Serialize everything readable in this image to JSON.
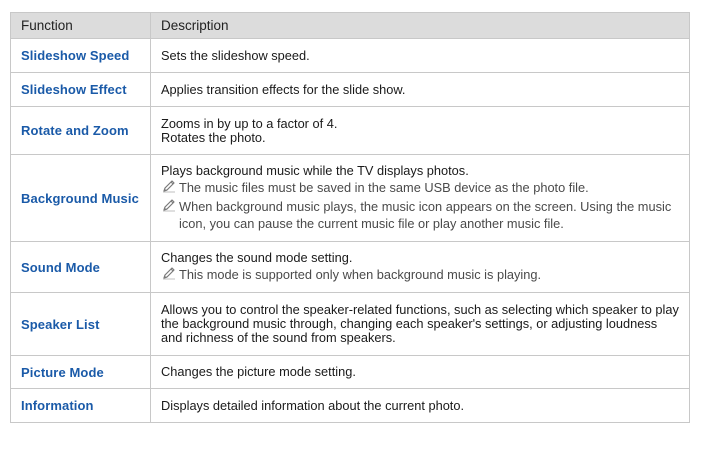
{
  "table": {
    "headers": {
      "function": "Function",
      "description": "Description"
    },
    "rows": [
      {
        "function": "Slideshow Speed",
        "lines": [
          "Sets the slideshow speed."
        ],
        "notes": []
      },
      {
        "function": "Slideshow Effect",
        "lines": [
          "Applies transition effects for the slide show."
        ],
        "notes": []
      },
      {
        "function": "Rotate and Zoom",
        "lines": [
          "Zooms in by up to a factor of 4.",
          "Rotates the photo."
        ],
        "notes": []
      },
      {
        "function": "Background Music",
        "lines": [
          "Plays background music while the TV displays photos."
        ],
        "notes": [
          "The music files must be saved in the same USB device as the photo file.",
          "When background music plays, the music icon appears on the screen. Using the music icon, you can pause the current music file or play another music file."
        ]
      },
      {
        "function": "Sound Mode",
        "lines": [
          "Changes the sound mode setting."
        ],
        "notes": [
          "This mode is supported only when background music is playing."
        ]
      },
      {
        "function": "Speaker List",
        "lines": [
          "Allows you to control the speaker-related functions, such as selecting which speaker to play the background music through, changing each speaker's settings, or adjusting loudness and richness of the sound from speakers."
        ],
        "notes": []
      },
      {
        "function": "Picture Mode",
        "lines": [
          "Changes the picture mode setting."
        ],
        "notes": []
      },
      {
        "function": "Information",
        "lines": [
          "Displays detailed information about the current photo."
        ],
        "notes": []
      }
    ]
  },
  "icons": {
    "note": "pencil-note-icon"
  }
}
